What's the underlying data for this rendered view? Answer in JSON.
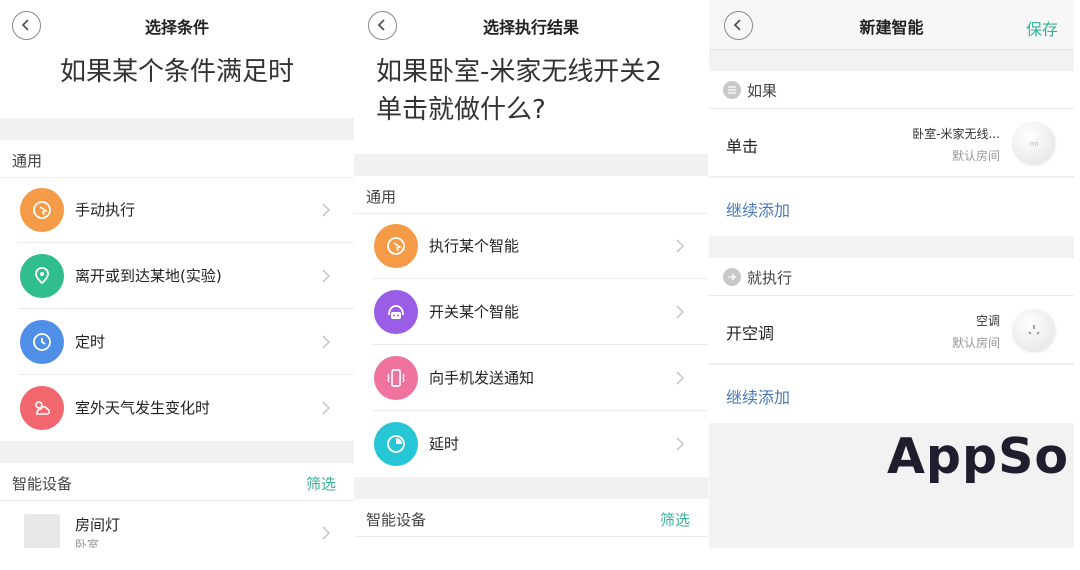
{
  "panel1": {
    "nav_title": "选择条件",
    "heading": "如果某个条件满足时",
    "general_section": "通用",
    "options": [
      {
        "label": "手动执行",
        "icon": "pointer-icon",
        "color": "#f59a47"
      },
      {
        "label": "离开或到达某地(实验)",
        "icon": "location-icon",
        "color": "#2fbe8c"
      },
      {
        "label": "定时",
        "icon": "clock-icon",
        "color": "#4f8fe8"
      },
      {
        "label": "室外天气发生变化时",
        "icon": "weather-icon",
        "color": "#f2676d"
      }
    ],
    "devices_section": "智能设备",
    "filter_label": "筛选",
    "device": {
      "name": "房间灯",
      "room": "卧室"
    }
  },
  "panel2": {
    "nav_title": "选择执行结果",
    "heading_line1": "如果卧室-米家无线开关2",
    "heading_line2": "单击就做什么?",
    "general_section": "通用",
    "options": [
      {
        "label": "执行某个智能",
        "icon": "pointer-icon",
        "color": "#f59a47"
      },
      {
        "label": "开关某个智能",
        "icon": "robot-icon",
        "color": "#9a5ee6"
      },
      {
        "label": "向手机发送通知",
        "icon": "phone-vibrate-icon",
        "color": "#f0729f"
      },
      {
        "label": "延时",
        "icon": "timer-icon",
        "color": "#26c6d6"
      }
    ],
    "devices_section": "智能设备",
    "filter_label": "筛选"
  },
  "panel3": {
    "nav_title": "新建智能",
    "save_label": "保存",
    "if_section": "如果",
    "if_row": {
      "action": "单击",
      "device": "卧室-米家无线...",
      "room": "默认房间"
    },
    "add_more_1": "继续添加",
    "then_section": "就执行",
    "then_row": {
      "action": "开空调",
      "device": "空调",
      "room": "默认房间"
    },
    "add_more_2": "继续添加",
    "logo_text": "AppSo"
  },
  "colors": {
    "accent": "#3bb39b",
    "link": "#4a78b8"
  }
}
